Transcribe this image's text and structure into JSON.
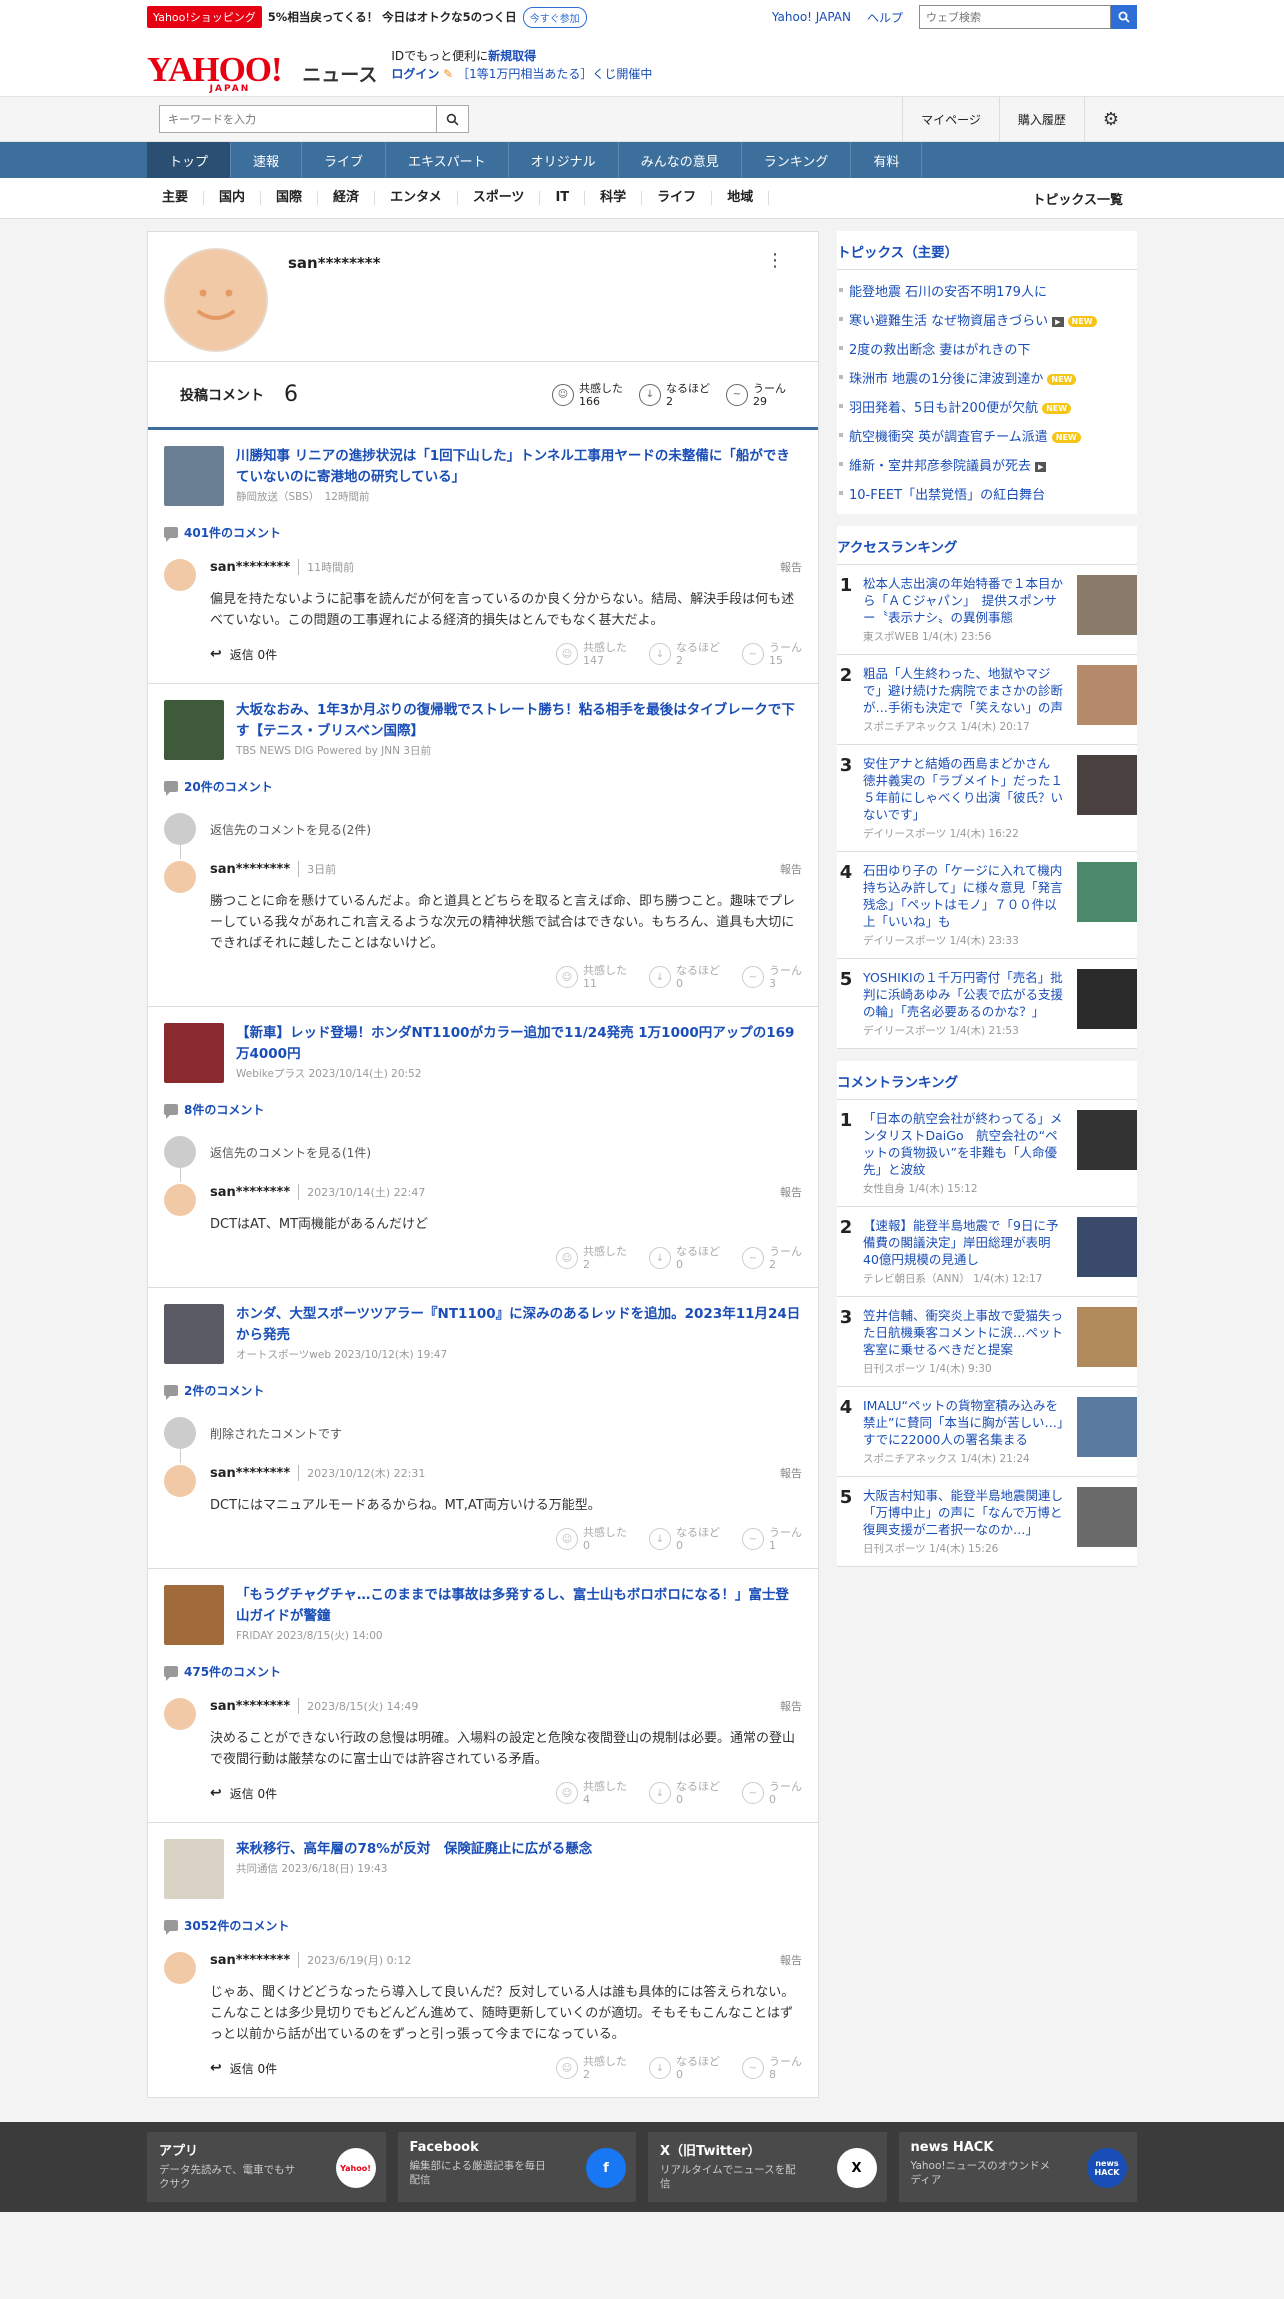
{
  "header": {
    "promo_badge": "Yahoo!ショッピング",
    "promo_text": "5%相当戻ってくる！ 今日はオトクな5のつく日",
    "promo_button": "今すぐ参加",
    "link_japan": "Yahoo! JAPAN",
    "link_help": "ヘルプ",
    "web_search_placeholder": "ウェブ検索",
    "logo_yahoo": "YAHOO!",
    "logo_japan": "JAPAN",
    "logo_news": "ニュース",
    "id_text": "IDでもっと便利に",
    "id_link": "新規取得",
    "login": "ログイン",
    "lottery": "［1等1万円相当あたる］くじ開催中"
  },
  "search": {
    "placeholder": "キーワードを入力",
    "mypage": "マイページ",
    "history": "購入履歴"
  },
  "gnav": [
    "トップ",
    "速報",
    "ライブ",
    "エキスパート",
    "オリジナル",
    "みんなの意見",
    "ランキング",
    "有料"
  ],
  "cnav": [
    "主要",
    "国内",
    "国際",
    "経済",
    "エンタメ",
    "スポーツ",
    "IT",
    "科学",
    "ライフ",
    "地域"
  ],
  "cnav_topics": "トピックス一覧",
  "profile": {
    "username": "san********",
    "comment_label": "投稿コメント",
    "comment_count": "6",
    "reactions": [
      {
        "label": "共感した",
        "count": "166"
      },
      {
        "label": "なるほど",
        "count": "2"
      },
      {
        "label": "うーん",
        "count": "29"
      }
    ]
  },
  "articles": [
    {
      "title": "川勝知事 リニアの進捗状況は「1回下山した」トンネル工事用ヤードの未整備に「船ができていないのに寄港地の研究している」",
      "source": "静岡放送（SBS）　12時間前",
      "count": "401件のコメント",
      "user": "san********",
      "time": "11時間前",
      "report": "報告",
      "text": "偏見を持たないように記事を読んだが何を言っているのか良く分からない。結局、解決手段は何も述べていない。この問題の工事遅れによる経済的損失はとんでもなく甚大だよ。",
      "reply": "返信 0件",
      "r": [
        "147",
        "2",
        "15"
      ]
    },
    {
      "title": "大坂なおみ、1年3か月ぶりの復帰戦でストレート勝ち！粘る相手を最後はタイブレークで下す【テニス・ブリスベン国際】",
      "source": "TBS NEWS DIG Powered by JNN 3日前",
      "count": "20件のコメント",
      "parent": "返信先のコメントを見る(2件)",
      "user": "san********",
      "time": "3日前",
      "report": "報告",
      "text": "勝つことに命を懸けているんだよ。命と道具とどちらを取ると言えば命、即ち勝つこと。趣味でプレーしている我々があれこれ言えるような次元の精神状態で試合はできない。もちろん、道具も大切にできればそれに越したことはないけど。",
      "r": [
        "11",
        "0",
        "3"
      ]
    },
    {
      "title": "【新車】レッド登場！ホンダNT1100がカラー追加で11/24発売 1万1000円アップの169万4000円",
      "source": "Webikeプラス 2023/10/14(土) 20:52",
      "count": "8件のコメント",
      "parent": "返信先のコメントを見る(1件)",
      "user": "san********",
      "time": "2023/10/14(土) 22:47",
      "report": "報告",
      "text": "DCTはAT、MT両機能があるんだけど",
      "r": [
        "2",
        "0",
        "2"
      ]
    },
    {
      "title": "ホンダ、大型スポーツツアラー『NT1100』に深みのあるレッドを追加。2023年11月24日から発売",
      "source": "オートスポーツweb 2023/10/12(木) 19:47",
      "count": "2件のコメント",
      "parent": "削除されたコメントです",
      "user": "san********",
      "time": "2023/10/12(木) 22:31",
      "report": "報告",
      "text": "DCTにはマニュアルモードあるからね。MT,AT両方いける万能型。",
      "r": [
        "0",
        "0",
        "1"
      ]
    },
    {
      "title": "「もうグチャグチャ…このままでは事故は多発するし、富士山もボロボロになる！」富士登山ガイドが警鐘",
      "source": "FRIDAY 2023/8/15(火) 14:00",
      "count": "475件のコメント",
      "user": "san********",
      "time": "2023/8/15(火) 14:49",
      "report": "報告",
      "text": "決めることができない行政の怠慢は明確。入場料の設定と危険な夜間登山の規制は必要。通常の登山で夜間行動は厳禁なのに富士山では許容されている矛盾。",
      "reply": "返信 0件",
      "r": [
        "4",
        "0",
        "0"
      ]
    },
    {
      "title": "来秋移行、高年層の78%が反対　保険証廃止に広がる懸念",
      "source": "共同通信 2023/6/18(日) 19:43",
      "count": "3052件のコメント",
      "user": "san********",
      "time": "2023/6/19(月) 0:12",
      "report": "報告",
      "text": "じゃあ、聞くけどどうなったら導入して良いんだ？反対している人は誰も具体的には答えられない。こんなことは多少見切りでもどんどん進めて、随時更新していくのが適切。そもそもこんなことはずっと以前から話が出ているのをずっと引っ張って今までになっている。",
      "reply": "返信 0件",
      "r": [
        "2",
        "0",
        "8"
      ]
    }
  ],
  "reaction_labels": [
    "共感した",
    "なるほど",
    "うーん"
  ],
  "topics": {
    "title": "トピックス（主要）",
    "items": [
      {
        "t": "能登地震 石川の安否不明179人に"
      },
      {
        "t": "寒い避難生活 なぜ物資届きづらい",
        "v": true,
        "n": true
      },
      {
        "t": "2度の救出断念 妻はがれきの下"
      },
      {
        "t": "珠洲市 地震の1分後に津波到達か",
        "n": true
      },
      {
        "t": "羽田発着、5日も計200便が欠航",
        "n": true
      },
      {
        "t": "航空機衝突 英が調査官チーム派遣",
        "n": true
      },
      {
        "t": "維新・室井邦彦参院議員が死去",
        "v": true
      },
      {
        "t": "10-FEET「出禁覚悟」の紅白舞台"
      }
    ]
  },
  "new_label": "NEW",
  "video_label": "▶",
  "access": {
    "title": "アクセスランキング",
    "items": [
      {
        "t": "松本人志出演の年始特番で１本目から「ＡＣジャパン」　提供スポンサー〝表示ナシ〟の異例事態",
        "m": "東スポWEB 1/4(木) 23:56"
      },
      {
        "t": "粗品「人生終わった、地獄やマジで」避け続けた病院でまさかの診断が…手術も決定で「笑えない」の声",
        "m": "スポニチアネックス 1/4(木) 20:17"
      },
      {
        "t": "安住アナと結婚の西島まどかさん　徳井義実の「ラブメイト」だった１５年前にしゃべくり出演「彼氏？いないです」",
        "m": "デイリースポーツ 1/4(木) 16:22"
      },
      {
        "t": "石田ゆり子の「ケージに入れて機内持ち込み許して」に様々意見「発言残念」「ペットはモノ」７００件以上「いいね」も",
        "m": "デイリースポーツ 1/4(木) 23:33"
      },
      {
        "t": "YOSHIKIの１千万円寄付「売名」批判に浜崎あゆみ「公表で広がる支援の輪」「売名必要あるのかな？」",
        "m": "デイリースポーツ 1/4(木) 21:53"
      }
    ]
  },
  "comment_rank": {
    "title": "コメントランキング",
    "items": [
      {
        "t": "「日本の航空会社が終わってる」メンタリストDaiGo　航空会社の“ペットの貨物扱い”を非難も「人命優先」と波紋",
        "m": "女性自身 1/4(木) 15:12"
      },
      {
        "t": "【速報】能登半島地震で「9日に予備費の閣議決定」岸田総理が表明　40億円規模の見通し",
        "m": "テレビ朝日系（ANN） 1/4(木) 12:17"
      },
      {
        "t": "笠井信輔、衝突炎上事故で愛猫失った日航機乗客コメントに涙…ペット客室に乗せるべきだと提案",
        "m": "日刊スポーツ 1/4(木) 9:30"
      },
      {
        "t": "IMALU“ペットの貨物室積み込みを禁止”に賛同「本当に胸が苦しい…」すでに22000人の署名集まる",
        "m": "スポニチアネックス 1/4(木) 21:24"
      },
      {
        "t": "大阪吉村知事、能登半島地震関連し「万博中止」の声に「なんで万博と復興支援が二者択一なのか…」",
        "m": "日刊スポーツ 1/4(木) 15:26"
      }
    ]
  },
  "footer": [
    {
      "t": "アプリ",
      "d": "データ先読みで、電車でもサクサク",
      "i": "Yahoo!"
    },
    {
      "t": "Facebook",
      "d": "編集部による厳選記事を毎日配信",
      "i": "f"
    },
    {
      "t": "X（旧Twitter）",
      "d": "リアルタイムでニュースを配信",
      "i": "X"
    },
    {
      "t": "news HACK",
      "d": "Yahoo!ニュースのオウンドメディア",
      "i": "news HACK"
    }
  ]
}
